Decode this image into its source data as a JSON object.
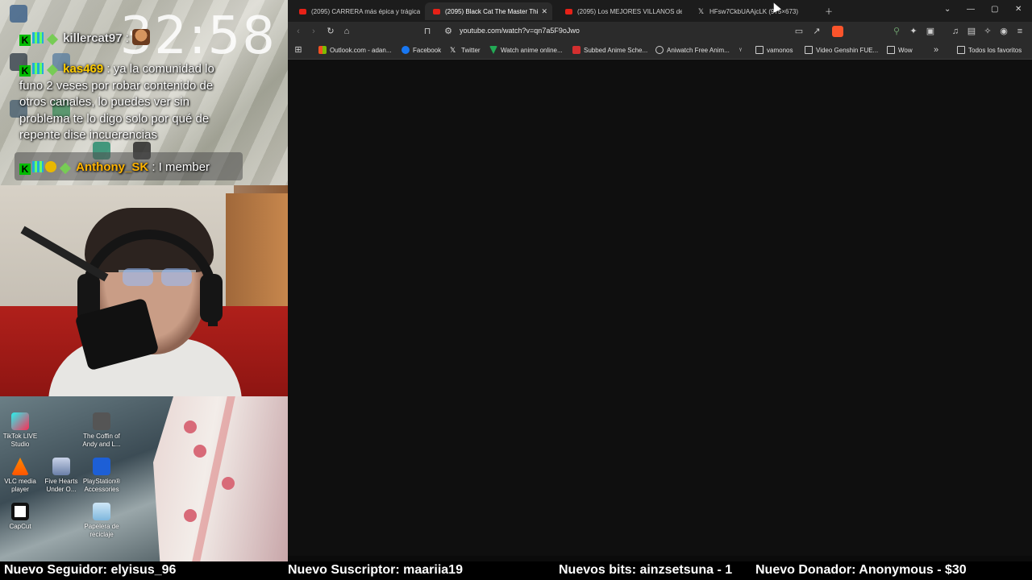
{
  "overlay": {
    "clock": "32:58",
    "chat": [
      {
        "user": "killercat97",
        "sep": " :",
        "text": ""
      },
      {
        "user": "kas469",
        "sep": " : ",
        "text": "ya la comunidad lo funo 2 veses por robar contenido de otros canales, lo puedes ver sin problema te lo digo solo por qué de repente dise incuerencias"
      },
      {
        "user": "Anthony_SK",
        "sep": " : ",
        "text": "I member"
      }
    ]
  },
  "desktop": {
    "icons": [
      {
        "label": "TikTok LIVE Studio"
      },
      {
        "label": "The Coffin of Andy and L..."
      },
      {
        "label": "VLC media player"
      },
      {
        "label": "Five Hearts Under O..."
      },
      {
        "label": "PlayStation® Accessories"
      },
      {
        "label": "CapCut"
      },
      {
        "label": "Papelera de reciclaje"
      }
    ]
  },
  "browser": {
    "tabs": [
      {
        "label": "(2095) CARRERA más épica y trágica",
        "icon": "youtube-icon"
      },
      {
        "label": "(2095) Black Cat The Master Thi",
        "icon": "youtube-icon",
        "active": true
      },
      {
        "label": "(2095) Los MEJORES VILLANOS del A",
        "icon": "youtube-icon"
      },
      {
        "label": "HFsw7CkbUAAjcLK (975×673)",
        "icon": "x-icon"
      }
    ],
    "url": "youtube.com/watch?v=qn7a5F9oJwo",
    "bookmarks": [
      {
        "label": "Outlook.com - adan...",
        "icon": "outlook-icon",
        "color": "#f25022"
      },
      {
        "label": "Facebook",
        "icon": "facebook-icon",
        "color": "#1877f2"
      },
      {
        "label": "Twitter",
        "icon": "x-icon",
        "color": "#ffffff"
      },
      {
        "label": "Watch anime online...",
        "icon": "anime-icon",
        "color": "#22aa55"
      },
      {
        "label": "Subbed Anime Sche...",
        "icon": "anime-schedule-icon",
        "color": "#d32f2f"
      },
      {
        "label": "Aniwatch Free Anim...",
        "icon": "aniwatch-icon",
        "color": "#cccccc"
      },
      {
        "label": "",
        "icon": "bookmark-icon",
        "color": "#cccccc"
      },
      {
        "label": "vamonos",
        "icon": "folder-icon"
      },
      {
        "label": "Video Genshin FUE...",
        "icon": "folder-icon"
      },
      {
        "label": "Wow",
        "icon": "folder-icon"
      },
      {
        "label": "Todos los favoritos",
        "icon": "folder-icon"
      }
    ]
  },
  "ticker": {
    "follower": "Nuevo Seguidor: elyisus_96",
    "subscriber": "Nuevo Suscriptor: maariia19",
    "bits": "Nuevos bits: ainzsetsuna - 1",
    "donor": "Nuevo Donador: Anonymous - $30"
  },
  "colors": {
    "accent_youtube": "#e62117",
    "brave": "#fb542b"
  }
}
